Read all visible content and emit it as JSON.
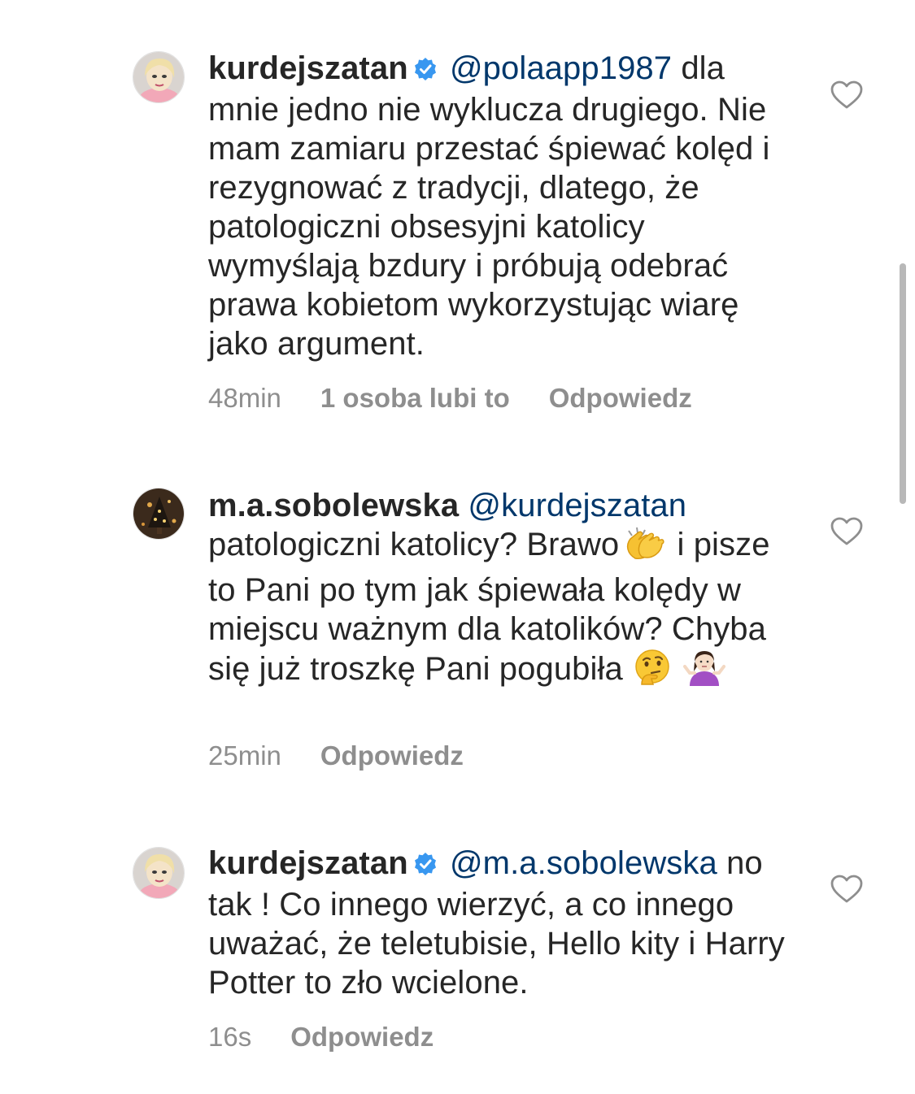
{
  "comments": [
    {
      "username": "kurdejszatan",
      "verified": true,
      "mention": "@polaapp1987",
      "text": "dla mnie jedno nie wyklucza drugiego. Nie mam zamiaru przestać śpiewać kolęd i rezygnować z tradycji, dlatego, że patologiczni obsesyjni katolicy wymyślają bzdury i próbują odebrać prawa kobietom wykorzystując wiarę jako argument.",
      "time": "48min",
      "likes": "1 osoba lubi to",
      "reply_label": "Odpowiedz",
      "avatar_icon": "profile-photo-blonde-woman"
    },
    {
      "username": "m.a.sobolewska",
      "verified": false,
      "mention": "@kurdejszatan",
      "text_part1": "patologiczni katolicy? Brawo",
      "emoji1": "clapping-hands-emoji",
      "text_part2": "i pisze to Pani po tym jak śpiewała kolędy w miejscu ważnym dla katolików? Chyba się już troszkę Pani pogubiła",
      "emoji2": "thinking-face-emoji",
      "emoji3": "person-shrugging-emoji",
      "time": "25min",
      "reply_label": "Odpowiedz",
      "avatar_icon": "profile-photo-dark-tree"
    },
    {
      "username": "kurdejszatan",
      "verified": true,
      "mention": "@m.a.sobolewska",
      "text": "no tak ! Co innego wierzyć, a co innego uważać, że teletubisie, Hello kity i Harry Potter to zło wcielone.",
      "time": "16s",
      "reply_label": "Odpowiedz",
      "avatar_icon": "profile-photo-blonde-woman"
    }
  ],
  "colors": {
    "text": "#262626",
    "mention": "#00376b",
    "meta": "#8e8e8e",
    "verified": "#3897f0"
  },
  "icons": {
    "like": "heart-outline-icon",
    "verified": "verified-badge-icon"
  }
}
